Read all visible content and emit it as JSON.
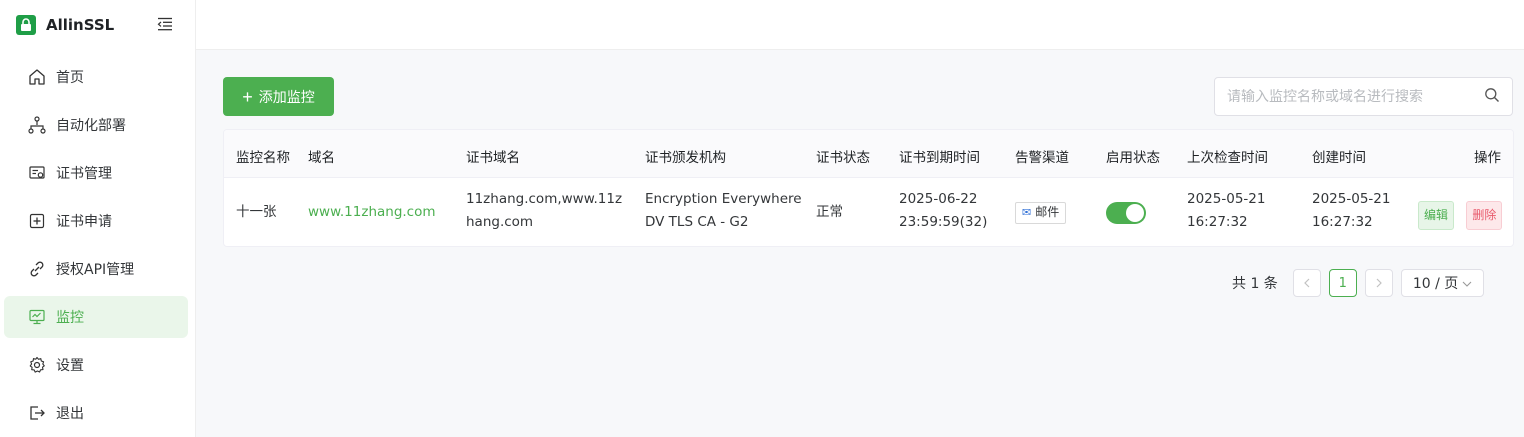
{
  "app": {
    "name": "AllinSSL"
  },
  "sidebar": {
    "items": [
      {
        "label": "首页",
        "icon": "home-icon",
        "active": false
      },
      {
        "label": "自动化部署",
        "icon": "workflow-icon",
        "active": false
      },
      {
        "label": "证书管理",
        "icon": "certificate-icon",
        "active": false
      },
      {
        "label": "证书申请",
        "icon": "plus-square-icon",
        "active": false
      },
      {
        "label": "授权API管理",
        "icon": "api-link-icon",
        "active": false
      },
      {
        "label": "监控",
        "icon": "monitor-icon",
        "active": true
      },
      {
        "label": "设置",
        "icon": "gear-icon",
        "active": false
      },
      {
        "label": "退出",
        "icon": "logout-icon",
        "active": false
      }
    ]
  },
  "toolbar": {
    "add_label": "添加监控",
    "search_placeholder": "请输入监控名称或域名进行搜索"
  },
  "table": {
    "columns": [
      "监控名称",
      "域名",
      "证书域名",
      "证书颁发机构",
      "证书状态",
      "证书到期时间",
      "告警渠道",
      "启用状态",
      "上次检查时间",
      "创建时间",
      "操作"
    ],
    "rows": [
      {
        "name": "十一张",
        "domain": "www.11zhang.com",
        "cert_domain_line1": "11zhang.com,www.11z",
        "cert_domain_line2": "hang.com",
        "issuer_line1": "Encryption Everywhere",
        "issuer_line2": "DV TLS CA - G2",
        "status": "正常",
        "expire_line1": "2025-06-22",
        "expire_line2": "23:59:59(32)",
        "channel": "邮件",
        "enabled": true,
        "last_check_line1": "2025-05-21",
        "last_check_line2": "16:27:32",
        "created_line1": "2025-05-21",
        "created_line2": "16:27:32",
        "edit_label": "编辑",
        "delete_label": "删除"
      }
    ]
  },
  "pagination": {
    "total": "共 1 条",
    "current_page": "1",
    "page_size": "10 / 页"
  },
  "colors": {
    "accent": "#4caf50",
    "danger": "#e8596b"
  }
}
